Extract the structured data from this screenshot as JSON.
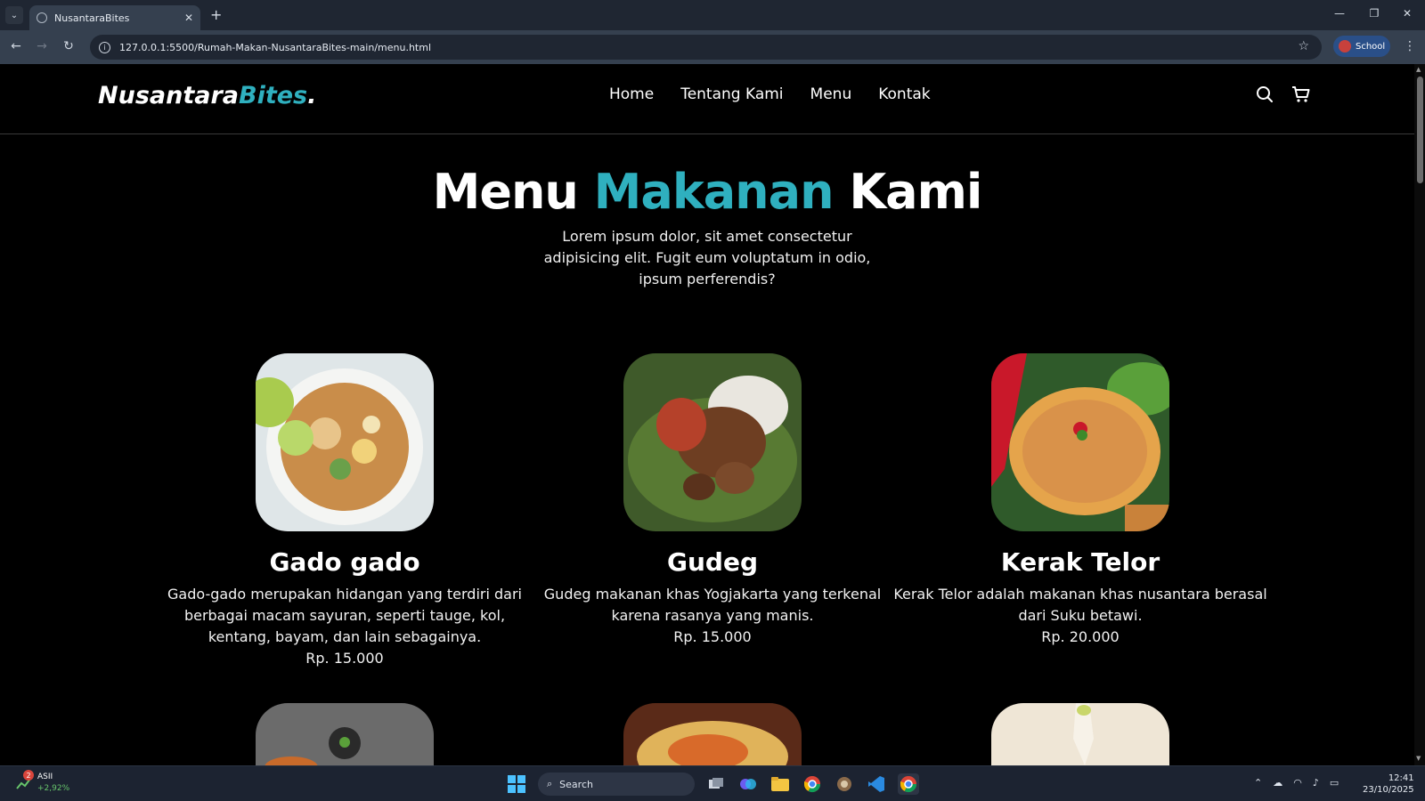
{
  "browser": {
    "tab_title": "NusantaraBites",
    "tab_close": "✕",
    "new_tab": "+",
    "url": "127.0.0.1:5500/Rumah-Makan-NusantaraBites-main/menu.html",
    "profile_label": "School",
    "window_controls": {
      "minimize": "—",
      "maximize": "❐",
      "close": "✕"
    }
  },
  "site": {
    "logo_main": "Nusantara",
    "logo_accent": "Bites",
    "logo_dot": ".",
    "nav": [
      "Home",
      "Tentang Kami",
      "Menu",
      "Kontak"
    ],
    "icons": [
      "search-icon",
      "cart-icon"
    ]
  },
  "hero": {
    "title_part1": "Menu",
    "title_accent": "Makanan",
    "title_part2": "Kami",
    "description": "Lorem ipsum dolor, sit amet consectetur adipisicing elit. Fugit eum voluptatum in odio, ipsum perferendis?"
  },
  "menu_items": [
    {
      "name": "Gado gado",
      "description": "Gado-gado merupakan hidangan yang terdiri dari berbagai macam sayuran, seperti tauge, kol, kentang, bayam, dan lain sebagainya.",
      "price": "Rp. 15.000"
    },
    {
      "name": "Gudeg",
      "description": "Gudeg makanan khas Yogjakarta yang terkenal karena rasanya yang manis.",
      "price": "Rp. 15.000"
    },
    {
      "name": "Kerak Telor",
      "description": "Kerak Telor adalah makanan khas nusantara berasal dari Suku betawi.",
      "price": "Rp. 20.000"
    }
  ],
  "taskbar": {
    "stock_name": "ASII",
    "stock_change": "+2,92%",
    "stock_badge": "2",
    "search_placeholder": "Search",
    "time": "12:41",
    "date": "23/10/2025"
  },
  "colors": {
    "accent": "#2fb0bf",
    "background": "#000000"
  }
}
